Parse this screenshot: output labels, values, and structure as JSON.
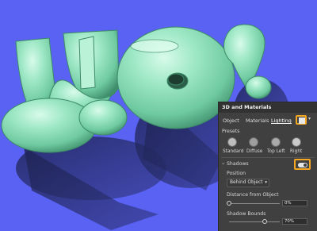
{
  "scene": {
    "background_color": "#5962f2",
    "letter_color": "#8fe0b9",
    "text": "yo!"
  },
  "panel": {
    "title": "3D and Materials",
    "tabs": [
      "Object",
      "Materials",
      "Lighting"
    ],
    "active_tab": "Lighting",
    "lighting_icon": "light-source-icon",
    "presets_label": "Presets",
    "presets": [
      {
        "name": "Standard"
      },
      {
        "name": "Diffuse"
      },
      {
        "name": "Top Left"
      },
      {
        "name": "Right"
      }
    ],
    "shadows": {
      "label": "Shadows",
      "enabled": true,
      "position_label": "Position",
      "position_value": "Behind Object",
      "distance_label": "Distance from Object",
      "distance_value": "0%",
      "distance_fraction": 0.0,
      "bounds_label": "Shadow Bounds",
      "bounds_value": "70%",
      "bounds_fraction": 0.7
    },
    "highlight_color": "#f5a623"
  }
}
